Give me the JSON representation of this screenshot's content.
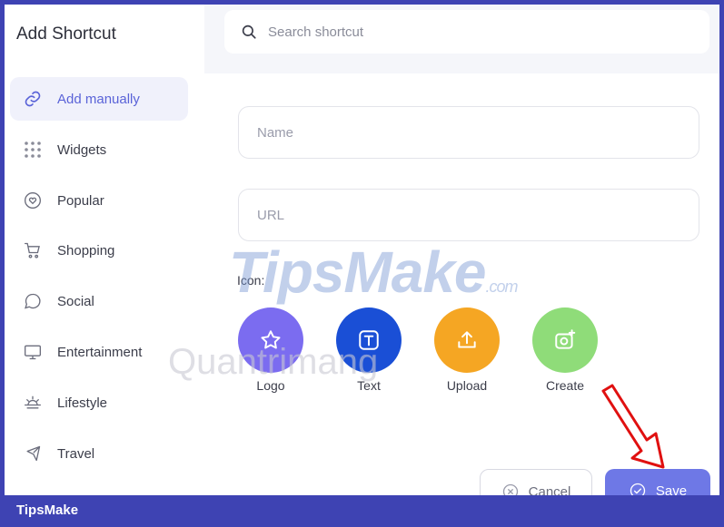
{
  "sidebar": {
    "title": "Add Shortcut",
    "items": [
      {
        "label": "Add manually"
      },
      {
        "label": "Widgets"
      },
      {
        "label": "Popular"
      },
      {
        "label": "Shopping"
      },
      {
        "label": "Social"
      },
      {
        "label": "Entertainment"
      },
      {
        "label": "Lifestyle"
      },
      {
        "label": "Travel"
      }
    ]
  },
  "search": {
    "placeholder": "Search shortcut"
  },
  "form": {
    "name_placeholder": "Name",
    "url_placeholder": "URL",
    "icon_label": "Icon:",
    "icon_options": [
      {
        "label": "Logo",
        "color": "#7b6cf0"
      },
      {
        "label": "Text",
        "color": "#1a4fd6"
      },
      {
        "label": "Upload",
        "color": "#f5a623"
      },
      {
        "label": "Create",
        "color": "#8fdc79"
      }
    ]
  },
  "buttons": {
    "cancel": "Cancel",
    "save": "Save"
  },
  "watermarks": {
    "tipsmake": "TipsMake",
    "tipsmake_suffix": ".com",
    "quantrimang": "Quantrimang"
  },
  "footer": {
    "brand": "TipsMake"
  },
  "colors": {
    "accent": "#5a63d8",
    "save_button": "#6e78e6",
    "frame": "#3e43b3"
  }
}
